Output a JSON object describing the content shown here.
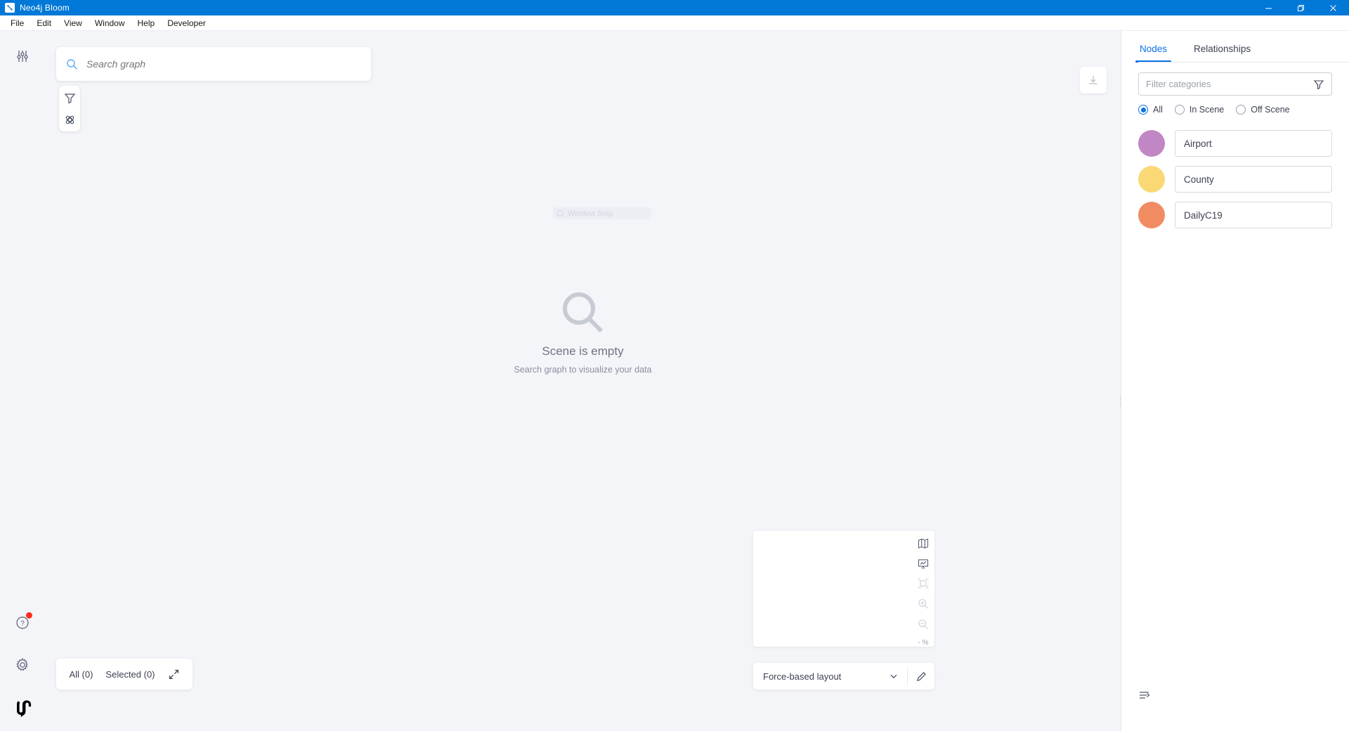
{
  "window": {
    "title": "Neo4j Bloom",
    "app_icon": "neo4j-bloom-icon",
    "controls": {
      "minimize": "minimize-icon",
      "maximize": "restore-icon",
      "close": "close-icon"
    }
  },
  "menubar": {
    "items": [
      {
        "label": "File"
      },
      {
        "label": "Edit"
      },
      {
        "label": "View"
      },
      {
        "label": "Window"
      },
      {
        "label": "Help"
      },
      {
        "label": "Developer"
      }
    ]
  },
  "rail": {
    "top_icon": "sliders-icon",
    "bottom_icons": [
      {
        "name": "help-icon",
        "glyph": "?",
        "has_badge": true
      },
      {
        "name": "gear-icon"
      },
      {
        "name": "neo4j-logo-icon"
      }
    ]
  },
  "search": {
    "placeholder": "Search graph",
    "value": "",
    "icon": "search-icon"
  },
  "canvas_tools": {
    "buttons": [
      {
        "name": "filter-icon"
      },
      {
        "name": "atom-icon"
      }
    ],
    "download_icon": "download-icon"
  },
  "snip_overlay": {
    "label": "Window Snip"
  },
  "empty_state": {
    "icon": "search-large-icon",
    "title": "Scene is empty",
    "subtitle": "Search graph to visualize your data"
  },
  "minimap": {
    "tools": [
      {
        "name": "map-icon",
        "dim": false
      },
      {
        "name": "slideshow-icon",
        "dim": false
      },
      {
        "name": "fit-to-screen-icon",
        "dim": true
      },
      {
        "name": "zoom-in-icon",
        "dim": true
      },
      {
        "name": "zoom-out-icon",
        "dim": true
      }
    ],
    "zoom_level": "- %"
  },
  "layout_bar": {
    "selected": "Force-based layout",
    "chevron_icon": "chevron-down-icon",
    "edit_icon": "pencil-icon"
  },
  "status_bar": {
    "all_label": "All (0)",
    "selected_label": "Selected (0)",
    "expand_icon": "expand-icon"
  },
  "panel": {
    "tabs": [
      {
        "label": "Nodes",
        "active": true
      },
      {
        "label": "Relationships",
        "active": false
      }
    ],
    "filter": {
      "placeholder": "Filter categories",
      "value": "",
      "icon": "funnel-icon"
    },
    "scope_options": [
      {
        "label": "All",
        "selected": true
      },
      {
        "label": "In Scene",
        "selected": false
      },
      {
        "label": "Off Scene",
        "selected": false
      }
    ],
    "categories": [
      {
        "label": "Airport",
        "color": "#c186c4"
      },
      {
        "label": "County",
        "color": "#fbd876"
      },
      {
        "label": "DailyC19",
        "color": "#f08b62"
      }
    ],
    "footer_icon": "sort-icon"
  },
  "colors": {
    "titlebar": "#0078d7",
    "accent": "#0b72e7",
    "canvas_bg": "#f4f5f9",
    "panel_bg": "#ffffff"
  }
}
